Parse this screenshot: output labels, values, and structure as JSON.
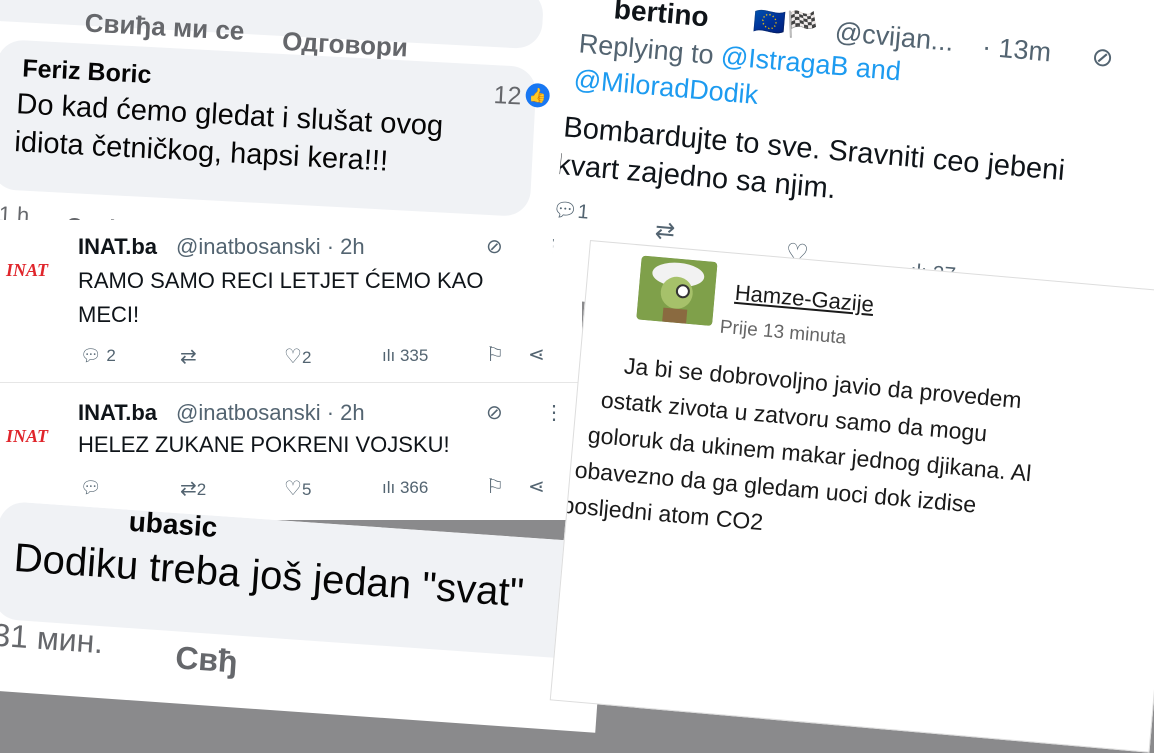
{
  "fb_top": {
    "prev_like": "Свиђа ми се",
    "prev_reply": "Одговори",
    "author": "Feriz Boric",
    "text_line1": "Do kad ćemo gledat i slušat ovog",
    "text_line2": "idiota četničkog, hapsi kera!!!",
    "reaction_count": "12",
    "time": "1 h",
    "like": "Свиђа ми се"
  },
  "tweets": [
    {
      "avatar_text": "INAT",
      "name": "INAT.ba",
      "handle": "@inatbosanski · 2h",
      "text_line1": "RAMO SAMO RECI LETJET ĆEMO KAO",
      "text_line2": "MECI!",
      "replies": "2",
      "retweets": "",
      "likes": "2",
      "views": "335"
    },
    {
      "avatar_text": "INAT",
      "name": "INAT.ba",
      "handle": "@inatbosanski · 2h",
      "text_line1": "HELEZ ZUKANE POKRENI VOJSKU!",
      "text_line2": "",
      "replies": "",
      "retweets": "2",
      "likes": "5",
      "views": "366"
    }
  ],
  "fb_bottom": {
    "author_partial": "ubasic",
    "text": "Dodiku treba još jedan \"svat\"",
    "time": "31 мин.",
    "like_partial": "Свђ"
  },
  "right_tweet": {
    "author_partial": "bertino",
    "handle": "@cvijan...",
    "time": "· 13m",
    "reply_prefix": "Replying to ",
    "reply_mention1": "@IstragaB and",
    "reply_mention2": "@MiloradDodik",
    "text_line1": "Bombardujte to sve. Sravniti ceo jebeni",
    "text_line2": "kvart zajedno sa njim.",
    "replies": "1",
    "views": "27"
  },
  "forum": {
    "username": "Hamze-Gazije",
    "time": "Prije 13 minuta",
    "lines": [
      "Ja bi se dobrovoljno javio da provedem",
      "ostatk zivota u zatvoru samo da mogu",
      "goloruk da ukinem makar jednog djikana. Al",
      "obavezno da ga gledam uoci dok izdise",
      "posljedni atom CO2"
    ]
  },
  "colors": {
    "link": "#1d9bf0",
    "inat_red": "#e0252b",
    "fb_blue": "#1877f2"
  }
}
